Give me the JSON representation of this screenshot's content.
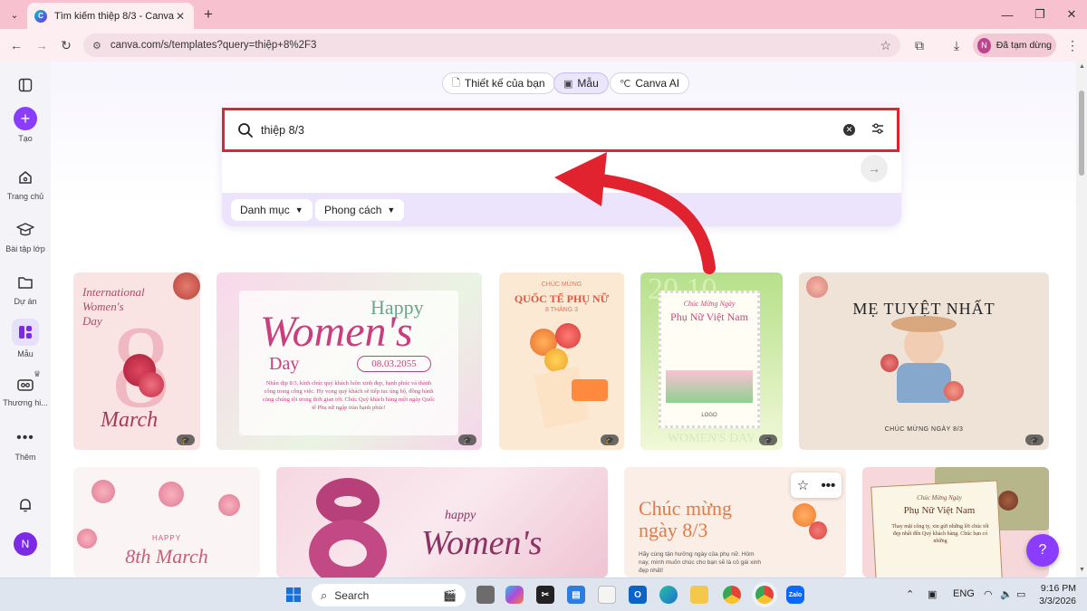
{
  "browser": {
    "tab_title": "Tìm kiếm thiệp 8/3 - Canva",
    "url": "canva.com/s/templates?query=thiệp+8%2F3",
    "profile_initial": "N",
    "profile_status": "Đã tạm dừng"
  },
  "rail": {
    "create": "Tạo",
    "home": "Trang chủ",
    "classwork": "Bài tập lớp",
    "projects": "Dự án",
    "templates": "Mẫu",
    "brand": "Thương hi...",
    "more": "Thêm",
    "avatar_initial": "N"
  },
  "segments": {
    "your_designs": "Thiết kế của bạn",
    "templates": "Mẫu",
    "canva_ai": "Canva AI"
  },
  "search": {
    "query": "thiệp 8/3",
    "chip_category": "Danh mục",
    "chip_style": "Phong cách"
  },
  "cards": {
    "c1": {
      "line1": "International",
      "line2": "Women's",
      "line3": "Day",
      "big": "8",
      "script": "March"
    },
    "c2": {
      "happy": "Happy",
      "womens": "Women's",
      "day": "Day",
      "date": "08.03.2055",
      "body": "Nhân dịp 8/3, kính chúc quý khách luôn xinh đẹp, hạnh phúc và thành công trong công việc. Hy vọng quý khách sẽ tiếp tục ủng hộ, đồng hành cùng chúng tôi trong thời gian tới. Chúc Quý khách hàng một ngày Quốc tế Phụ nữ ngập tràn hạnh phúc!"
    },
    "c3": {
      "small": "CHÚC MỪNG",
      "title": "QUỐC TẾ PHỤ NỮ",
      "sub": "8 THÁNG 3"
    },
    "c4": {
      "bg_num": "20.10",
      "greet": "Chúc Mừng Ngày",
      "title": "Phụ Nữ Việt Nam",
      "logo": "LOGO",
      "bottom": "WOMEN'S DAY"
    },
    "c5": {
      "title": "MẸ TUYỆT NHẤT",
      "bottom": "CHÚC MỪNG NGÀY 8/3"
    },
    "c6": {
      "happy": "HAPPY",
      "script": "8th March"
    },
    "c7": {
      "happy": "happy",
      "womens": "Women's"
    },
    "c8": {
      "line1": "Chúc mừng",
      "line2": "ngày 8/3",
      "body": "Hãy cùng tận hưởng ngày của phụ nữ. Hôm nay, mình muốn chúc cho bạn sẽ là cô gái xinh đẹp nhất!"
    },
    "c9": {
      "greet": "Chúc Mừng Ngày",
      "title": "Phụ Nữ Việt Nam",
      "body": "Thay mặt công ty, xin gửi những lời chúc tốt đẹp nhất đến Quý khách hàng. Chúc bạn có những"
    }
  },
  "taskbar": {
    "search": "Search",
    "lang": "ENG",
    "time": "9:16 PM",
    "date": "3/3/2026"
  },
  "colors": {
    "accent": "#8b3dff",
    "highlight_box": "#e0232e",
    "annotation_arrow": "#e0232e",
    "browser_tabbar": "#f7c1cf"
  },
  "icons": [
    "menu-icon",
    "plus-icon",
    "home-icon",
    "graduation-cap-icon",
    "folder-icon",
    "templates-icon",
    "crown-icon",
    "briefcase-icon",
    "ellipsis-icon",
    "bell-icon",
    "search-icon",
    "clear-icon",
    "filter-sliders-icon",
    "arrow-right-icon",
    "chevron-down-icon",
    "star-icon",
    "help-icon",
    "windows-icon"
  ]
}
